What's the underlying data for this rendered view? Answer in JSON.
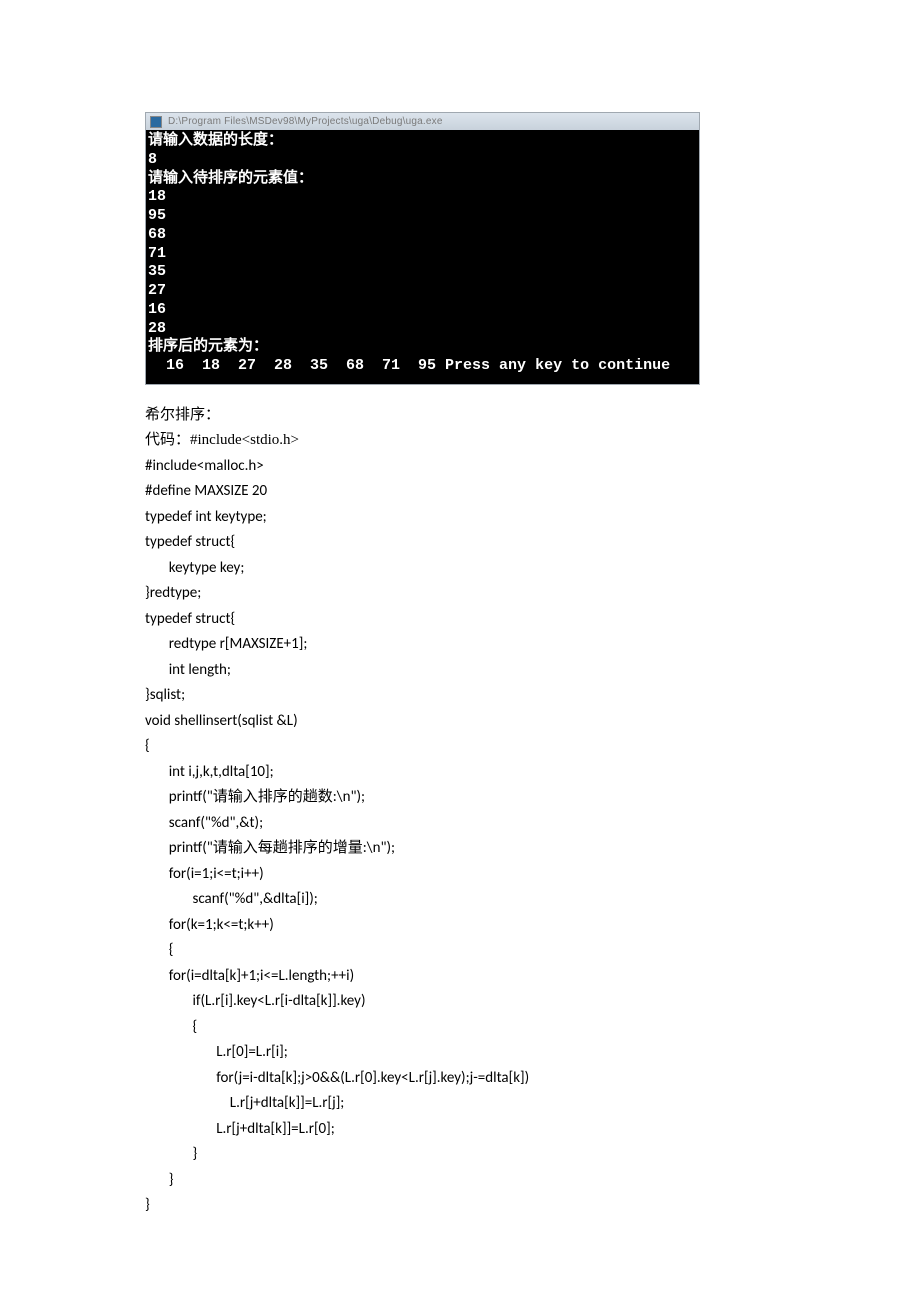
{
  "console": {
    "titlebar": "D:\\Program Files\\MSDev98\\MyProjects\\uga\\Debug\\uga.exe",
    "lines": [
      "请输入数据的长度：",
      "8",
      "请输入待排序的元素值：",
      "18",
      "95",
      "68",
      "71",
      "35",
      "27",
      "16",
      "28",
      "排序后的元素为：",
      "  16  18  27  28  35  68  71  95 Press any key to continue"
    ]
  },
  "section_title": "希尔排序：",
  "code_intro": "代码：#include<stdio.h>",
  "code_lines": [
    "#include<malloc.h>",
    "#define MAXSIZE 20",
    "typedef int keytype;",
    "typedef struct{",
    "       keytype key;",
    "}redtype;",
    "typedef struct{",
    "       redtype r[MAXSIZE+1];",
    "       int length;",
    "}sqlist;",
    "void shellinsert(sqlist &L)",
    "{",
    "       int i,j,k,t,dlta[10];",
    "       printf(\"请输入排序的趟数:\\n\");",
    "       scanf(\"%d\",&t);",
    "       printf(\"请输入每趟排序的增量:\\n\");",
    "       for(i=1;i<=t;i++)",
    "              scanf(\"%d\",&dlta[i]);",
    "       for(k=1;k<=t;k++)",
    "       {",
    "       for(i=dlta[k]+1;i<=L.length;++i)",
    "              if(L.r[i].key<L.r[i-dlta[k]].key)",
    "              {",
    "                     L.r[0]=L.r[i];",
    "                     for(j=i-dlta[k];j>0&&(L.r[0].key<L.r[j].key);j-=dlta[k])",
    "                         L.r[j+dlta[k]]=L.r[j];",
    "                     L.r[j+dlta[k]]=L.r[0];",
    "              }",
    "       }",
    "}"
  ]
}
